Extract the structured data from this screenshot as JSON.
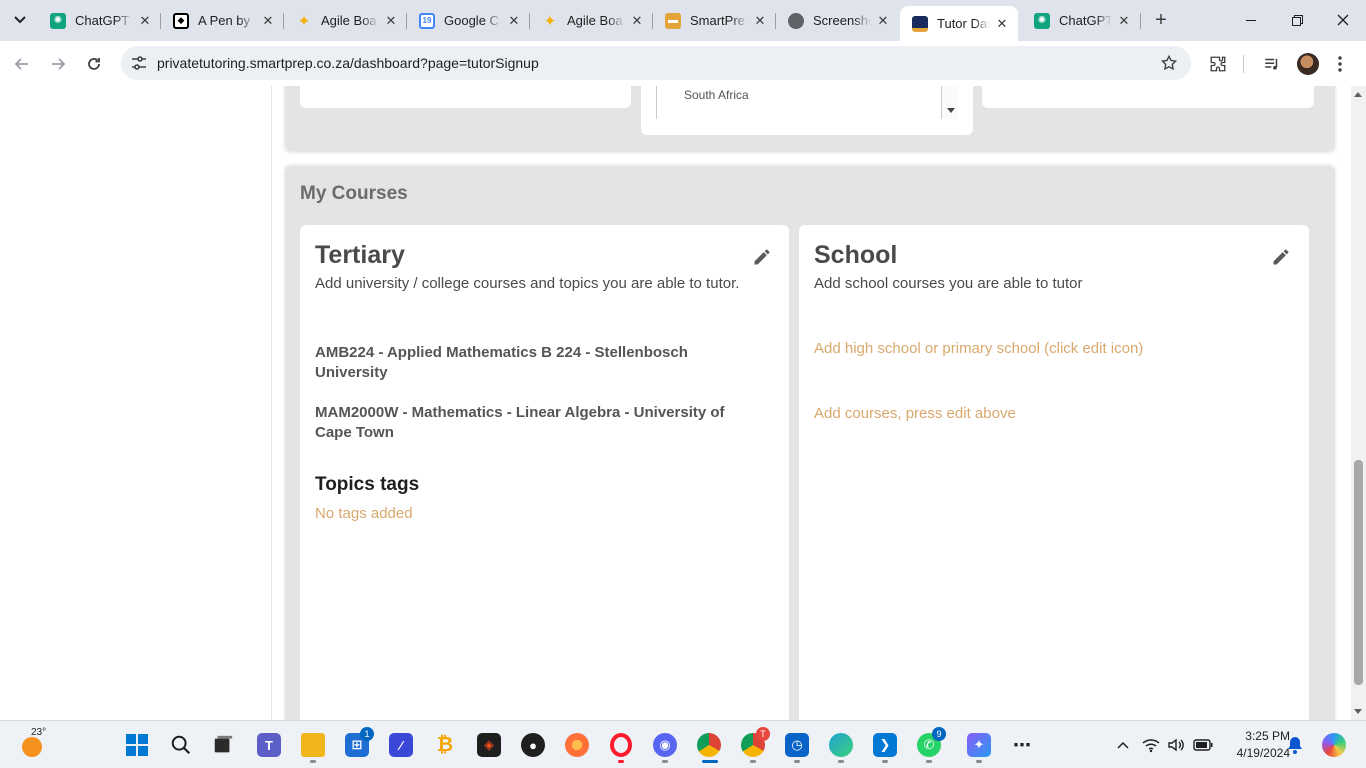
{
  "browser": {
    "tabs": [
      {
        "title": "ChatGPT",
        "favicon": "chatgpt-icon",
        "color": "#10a37f",
        "active": false
      },
      {
        "title": "A Pen by",
        "favicon": "codepen-icon",
        "color": "#000000",
        "active": false
      },
      {
        "title": "Agile Boa",
        "favicon": "sparkle-icon",
        "color": "#f6b100",
        "active": false
      },
      {
        "title": "Google C",
        "favicon": "google-calendar-icon",
        "color": "#4285f4",
        "active": false
      },
      {
        "title": "Agile Boa",
        "favicon": "sparkle-icon",
        "color": "#f6b100",
        "active": false
      },
      {
        "title": "SmartPre",
        "favicon": "smartprep-icon",
        "color": "#e3a53a",
        "active": false
      },
      {
        "title": "Screensho",
        "favicon": "globe-icon",
        "color": "#5f6368",
        "active": false
      },
      {
        "title": "Tutor Das",
        "favicon": "smartprep-icon",
        "color": "#1a2b5e",
        "active": true
      },
      {
        "title": "ChatGPT",
        "favicon": "chatgpt-icon",
        "color": "#10a37f",
        "active": false
      }
    ],
    "url": "privatetutoring.smartprep.co.za/dashboard?page=tutorSignup"
  },
  "top_section": {
    "country_value": "South Africa"
  },
  "courses": {
    "title": "My Courses",
    "tertiary": {
      "heading": "Tertiary",
      "description": "Add university / college courses and topics you are able to tutor.",
      "items": [
        {
          "line1": "AMB224 - Applied Mathematics B 224 - Stellenbosch",
          "line2": "University"
        },
        {
          "line1": "MAM2000W - Mathematics - Linear Algebra - University of",
          "line2": "Cape Town"
        }
      ],
      "topics_heading": "Topics tags",
      "topics_empty": "No tags added"
    },
    "school": {
      "heading": "School",
      "description": "Add school courses you are able to tutor",
      "school_hint": "Add high school or primary school (click edit icon)",
      "courses_hint": "Add courses, press edit above"
    },
    "hint_color": "#d9a86c"
  },
  "taskbar": {
    "weather_temp": "23°",
    "apps": [
      {
        "name": "windows-start-icon",
        "color": "#0078d4",
        "badge": ""
      },
      {
        "name": "search-icon",
        "color": "#1f1f1f",
        "badge": ""
      },
      {
        "name": "task-view-icon",
        "color": "#1f1f1f",
        "badge": ""
      },
      {
        "name": "teams-icon",
        "color": "#5b5fc7",
        "badge": ""
      },
      {
        "name": "file-explorer-icon",
        "color": "#f2b51b",
        "badge": ""
      },
      {
        "name": "microsoft-store-icon",
        "color": "#1f6ed4",
        "badge": "1"
      },
      {
        "name": "affinity-icon",
        "color": "#3b47d6",
        "badge": ""
      },
      {
        "name": "bitcoin-app-icon",
        "color": "#f7a600",
        "badge": ""
      },
      {
        "name": "figma-icon",
        "color": "#1e1e1e",
        "badge": ""
      },
      {
        "name": "github-icon",
        "color": "#1f1f1f",
        "badge": ""
      },
      {
        "name": "firefox-icon",
        "color": "#ff7139",
        "badge": ""
      },
      {
        "name": "opera-icon",
        "color": "#ff1b2d",
        "badge": ""
      },
      {
        "name": "discord-icon",
        "color": "#5865f2",
        "badge": ""
      },
      {
        "name": "chrome-icon",
        "color": "#db4437",
        "badge": ""
      },
      {
        "name": "chrome-profile-icon",
        "color": "#0f9d58",
        "badge": "T"
      },
      {
        "name": "outlook-icon",
        "color": "#0a64c8",
        "badge": ""
      },
      {
        "name": "edge-icon",
        "color": "#1fa3d6",
        "badge": ""
      },
      {
        "name": "vscode-icon",
        "color": "#0078d4",
        "badge": ""
      },
      {
        "name": "whatsapp-icon",
        "color": "#25d366",
        "badge": "9"
      },
      {
        "name": "copilot-icon",
        "color": "#8a5cf6",
        "badge": ""
      },
      {
        "name": "more-icon",
        "color": "#1f1f1f",
        "badge": ""
      }
    ],
    "time": "3:25 PM",
    "date": "4/19/2024"
  }
}
